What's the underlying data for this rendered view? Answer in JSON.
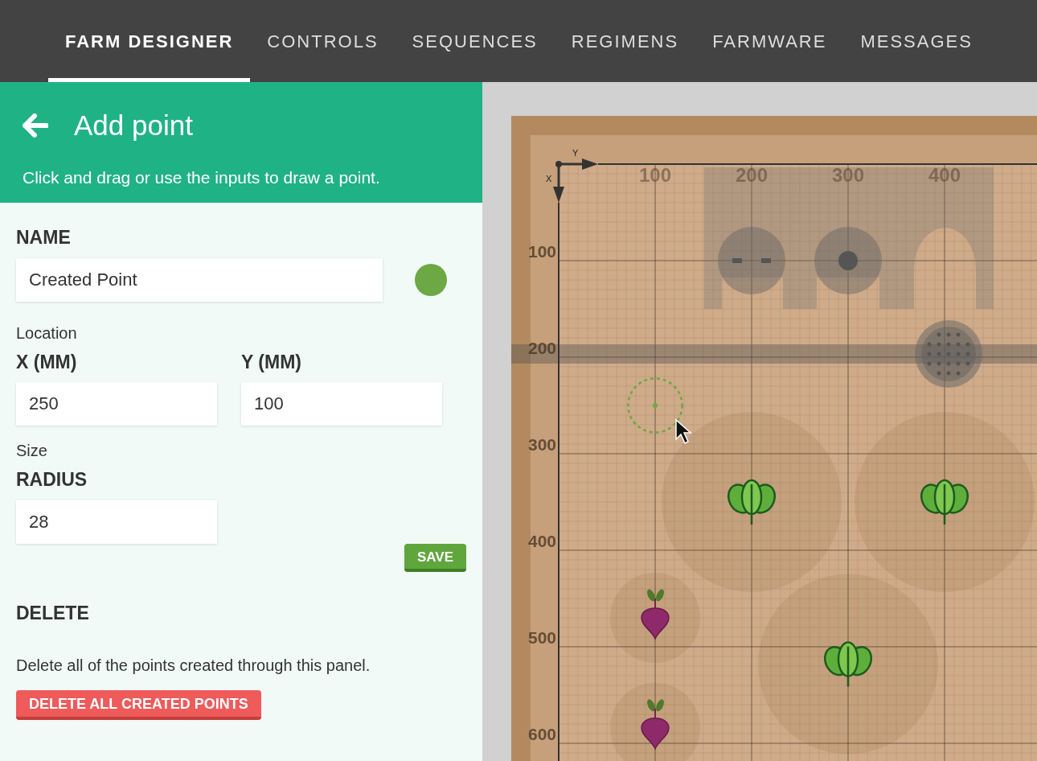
{
  "nav": [
    {
      "label": "FARM DESIGNER",
      "selected": true
    },
    {
      "label": "CONTROLS",
      "selected": false
    },
    {
      "label": "SEQUENCES",
      "selected": false
    },
    {
      "label": "REGIMENS",
      "selected": false
    },
    {
      "label": "FARMWARE",
      "selected": false
    },
    {
      "label": "MESSAGES",
      "selected": false
    }
  ],
  "panel": {
    "title": "Add point",
    "description": "Click and drag or use the inputs to draw a point.",
    "name_label": "NAME",
    "name_value": "Created Point",
    "location_label": "Location",
    "x_label": "X (MM)",
    "x_value": "250",
    "y_label": "Y (MM)",
    "y_value": "100",
    "size_label": "Size",
    "radius_label": "RADIUS",
    "radius_value": "28",
    "save": "SAVE",
    "delete_heading": "DELETE",
    "delete_text": "Delete all of the points created through this panel.",
    "delete_button": "DELETE ALL CREATED POINTS"
  },
  "map": {
    "axis_x": "X",
    "axis_y": "Y",
    "top_ticks": [
      "100",
      "200",
      "300",
      "400"
    ],
    "left_ticks": [
      "100",
      "200",
      "300",
      "400",
      "500",
      "600"
    ],
    "plants": [
      {
        "kind": "spinach"
      },
      {
        "kind": "spinach"
      },
      {
        "kind": "beet"
      },
      {
        "kind": "spinach"
      },
      {
        "kind": "beet"
      }
    ]
  }
}
